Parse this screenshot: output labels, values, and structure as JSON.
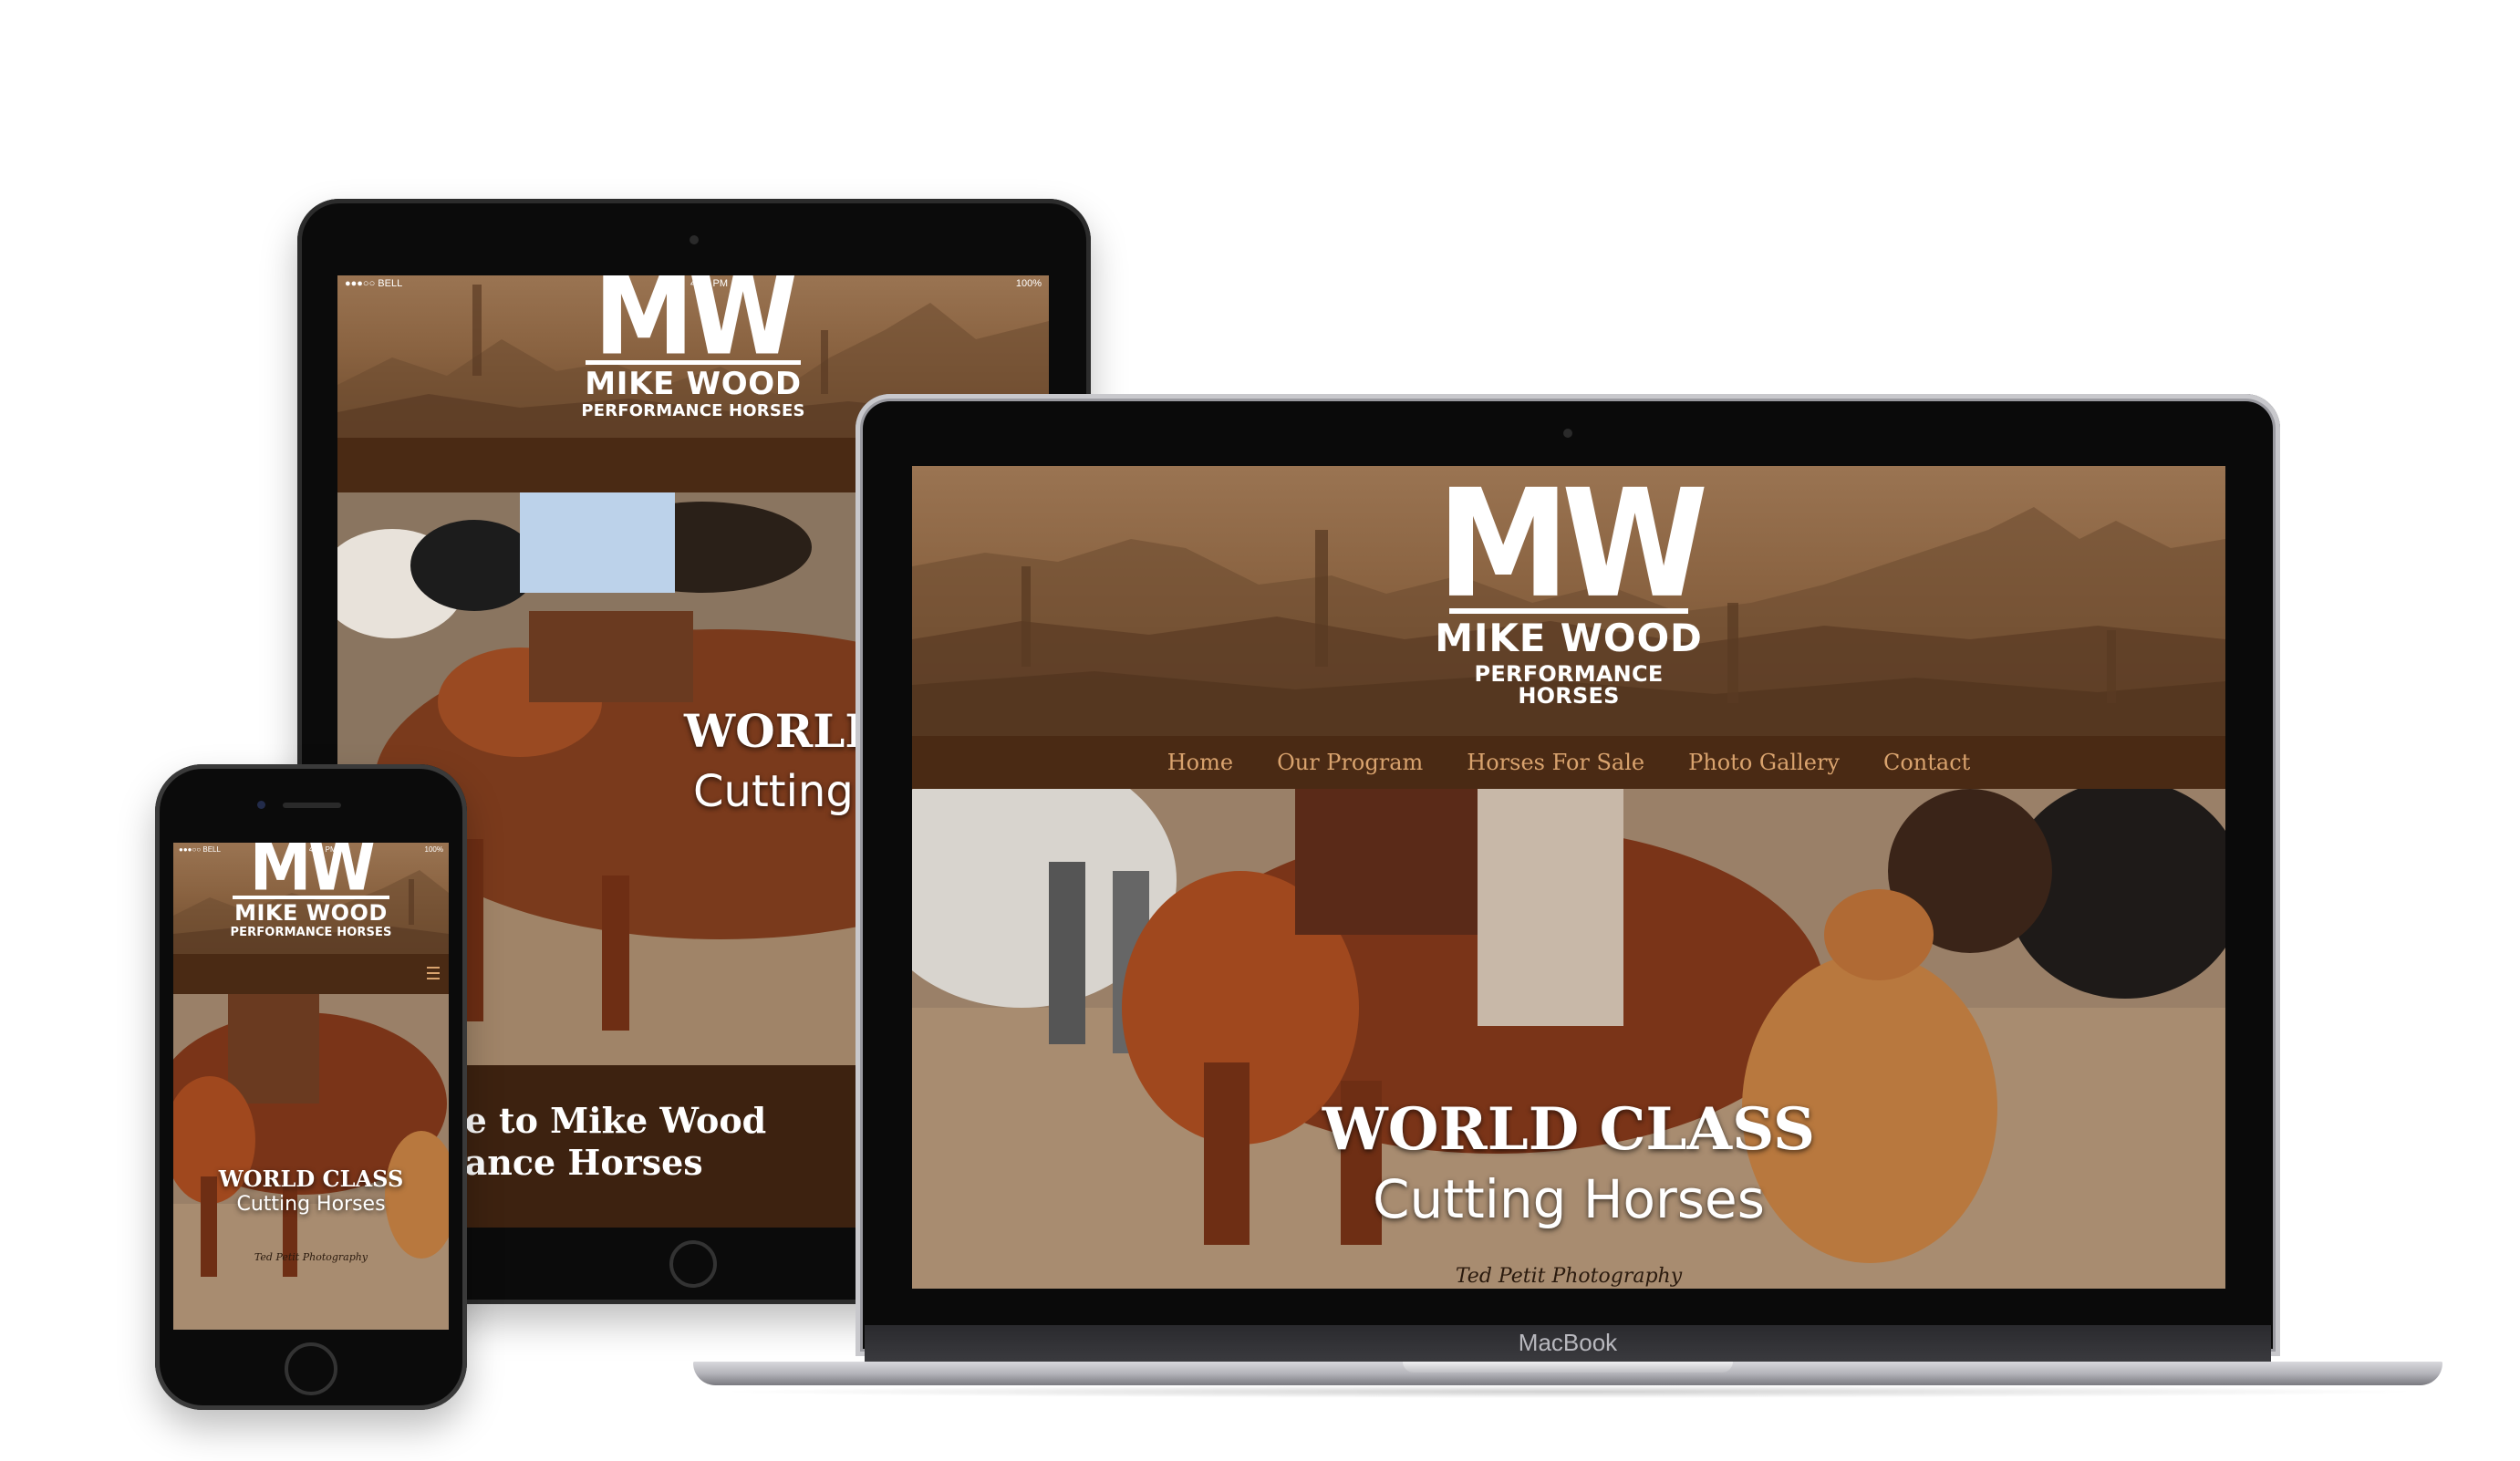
{
  "site": {
    "logo_mark": "MW",
    "logo_name": "MIKE WOOD",
    "logo_sub": "PERFORMANCE HORSES",
    "nav": [
      "Home",
      "Our Program",
      "Horses For Sale",
      "Photo Gallery",
      "Contact"
    ],
    "hero_title": "WORLD CLASS",
    "hero_sub": "Cutting Horses",
    "photo_credit": "Ted Petit Photography",
    "welcome_line1": "ne to Mike Wood",
    "welcome_line2": "nance Horses",
    "menu_icon": "hamburger-menu-icon"
  },
  "status": {
    "carrier": "●●●○○ BELL",
    "time": "4:21 PM",
    "battery": "100%"
  },
  "laptop": {
    "brand": "MacBook"
  },
  "colors": {
    "nav_bg": "#4a2a14",
    "nav_text": "#d9a36e",
    "header_brown": "#8a6341",
    "welcome_bg": "#3d2210"
  }
}
